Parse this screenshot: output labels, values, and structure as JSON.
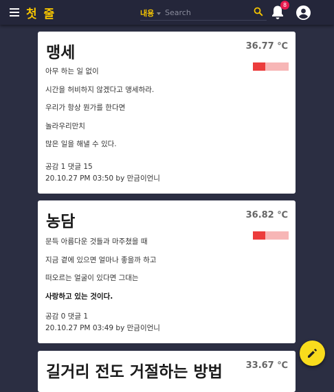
{
  "header": {
    "app_title": "첫 줄",
    "search_select": "내용",
    "search_placeholder": "Search",
    "notification_count": "8",
    "accent_color": "#f5c400",
    "badge_color": "#e8194d"
  },
  "icons": {
    "menu": "menu-icon",
    "search": "search-icon",
    "bell": "bell-icon",
    "account": "account-circle-icon",
    "edit": "pencil-icon"
  },
  "posts": [
    {
      "title": "맹세",
      "temperature": "36.77 ℃",
      "temperature_level": 0.35,
      "lines": [
        {
          "text": "아무 하는 일 없이",
          "bold": false
        },
        {
          "text": "시간을 허비하지 않겠다고 맹세하라.",
          "bold": false
        },
        {
          "text": "우리가 항상 뭔가를 한다면",
          "bold": false
        },
        {
          "text": "놀라우리만치",
          "bold": false
        },
        {
          "text": "많은 일을 해낼 수 있다.",
          "bold": false
        }
      ],
      "stats": "공감 1 댓글 15",
      "date_author": "20.10.27 PM 03:50 by 만금이언니"
    },
    {
      "title": "농담",
      "temperature": "36.82 ℃",
      "temperature_level": 0.35,
      "lines": [
        {
          "text": "문득 아름다운 것들과 마주쳤을 때",
          "bold": false
        },
        {
          "text": "지금 곁에 있으면 얼마나 좋을까 하고",
          "bold": false
        },
        {
          "text": "떠오르는 얼굴이 있다면 그대는",
          "bold": false
        },
        {
          "text": "사랑하고 있는 것이다.",
          "bold": true
        }
      ],
      "stats": "공감 0 댓글 1",
      "date_author": "20.10.27 PM 03:49 by 만금이언니"
    },
    {
      "title": "길거리 전도 거절하는 방법",
      "temperature": "33.67 ℃"
    }
  ]
}
